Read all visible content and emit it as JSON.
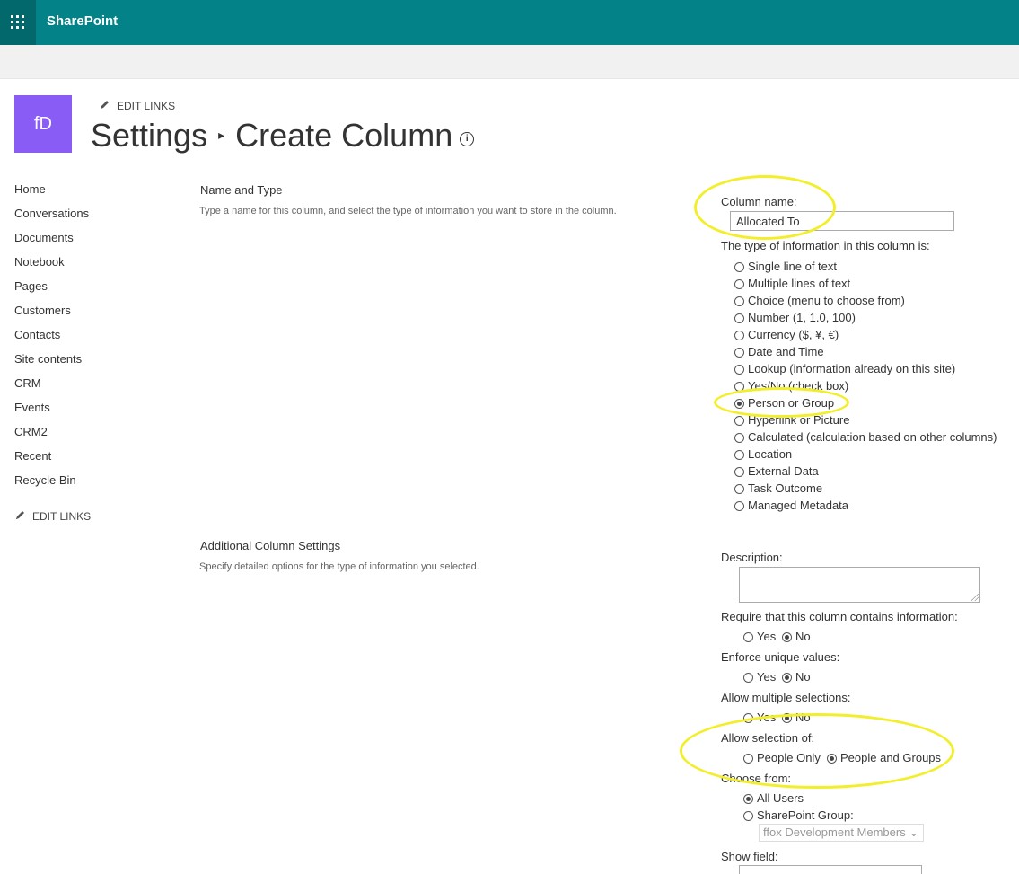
{
  "suite": {
    "brand": "SharePoint"
  },
  "site": {
    "logo_initials": "fD",
    "edit_links": "EDIT LINKS"
  },
  "page": {
    "title_part1": "Settings",
    "separator": "▸",
    "title_part2": "Create Column",
    "info_glyph": "i"
  },
  "nav": {
    "items": [
      "Home",
      "Conversations",
      "Documents",
      "Notebook",
      "Pages",
      "Customers",
      "Contacts",
      "Site contents",
      "CRM",
      "Events",
      "CRM2",
      "Recent",
      "Recycle Bin"
    ],
    "edit_links": "EDIT LINKS"
  },
  "section_name_type": {
    "title": "Name and Type",
    "description": "Type a name for this column, and select the type of information you want to store in the column."
  },
  "section_additional": {
    "title": "Additional Column Settings",
    "description": "Specify detailed options for the type of information you selected."
  },
  "form": {
    "column_name_label": "Column name:",
    "column_name_value": "Allocated To",
    "type_label": "The type of information in this column is:",
    "types": [
      {
        "label": "Single line of text",
        "selected": false
      },
      {
        "label": "Multiple lines of text",
        "selected": false
      },
      {
        "label": "Choice (menu to choose from)",
        "selected": false
      },
      {
        "label": "Number (1, 1.0, 100)",
        "selected": false
      },
      {
        "label": "Currency ($, ¥, €)",
        "selected": false
      },
      {
        "label": "Date and Time",
        "selected": false
      },
      {
        "label": "Lookup (information already on this site)",
        "selected": false
      },
      {
        "label": "Yes/No (check box)",
        "selected": false
      },
      {
        "label": "Person or Group",
        "selected": true
      },
      {
        "label": "Hyperlink or Picture",
        "selected": false
      },
      {
        "label": "Calculated (calculation based on other columns)",
        "selected": false
      },
      {
        "label": "Location",
        "selected": false
      },
      {
        "label": "External Data",
        "selected": false
      },
      {
        "label": "Task Outcome",
        "selected": false
      },
      {
        "label": "Managed Metadata",
        "selected": false
      }
    ],
    "description_label": "Description:",
    "require_label": "Require that this column contains information:",
    "unique_label": "Enforce unique values:",
    "multiple_label": "Allow multiple selections:",
    "yes": "Yes",
    "no": "No",
    "selection_label": "Allow selection of:",
    "people_only": "People Only",
    "people_groups": "People and Groups",
    "choose_from_label": "Choose from:",
    "all_users": "All Users",
    "sp_group_label": "SharePoint Group:",
    "sp_group_value": "ffox Development Members",
    "show_field_label": "Show field:"
  },
  "colors": {
    "suite_bar": "#038387",
    "logo": "#8a5cf6",
    "highlight": "#f2ef2a"
  }
}
